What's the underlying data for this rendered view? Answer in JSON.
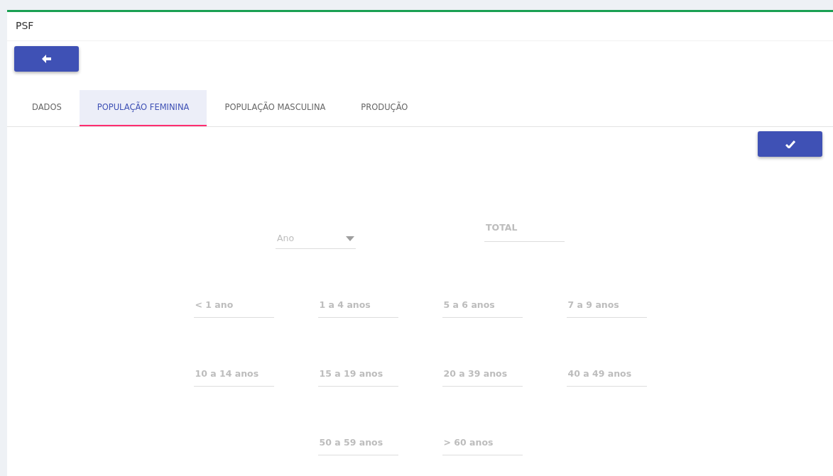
{
  "card": {
    "title": "PSF"
  },
  "tabs": [
    {
      "label": "DADOS",
      "selected": false
    },
    {
      "label": "POPULAÇÃO FEMININA",
      "selected": true
    },
    {
      "label": "POPULAÇÃO MASCULINA",
      "selected": false
    },
    {
      "label": "PRODUÇÃO",
      "selected": false
    }
  ],
  "year_select": {
    "placeholder": "Ano"
  },
  "total_field": {
    "placeholder": "TOTAL"
  },
  "age_fields": [
    [
      {
        "placeholder": "< 1 ano"
      },
      {
        "placeholder": "1 a 4 anos"
      },
      {
        "placeholder": "5 a 6 anos"
      },
      {
        "placeholder": "7 a 9 anos"
      }
    ],
    [
      {
        "placeholder": "10 a 14 anos"
      },
      {
        "placeholder": "15 a 19 anos"
      },
      {
        "placeholder": "20 a 39 anos"
      },
      {
        "placeholder": "40 a 49 anos"
      }
    ],
    [
      {
        "placeholder": "50 a 59 anos"
      },
      {
        "placeholder": "> 60 anos"
      }
    ]
  ]
}
